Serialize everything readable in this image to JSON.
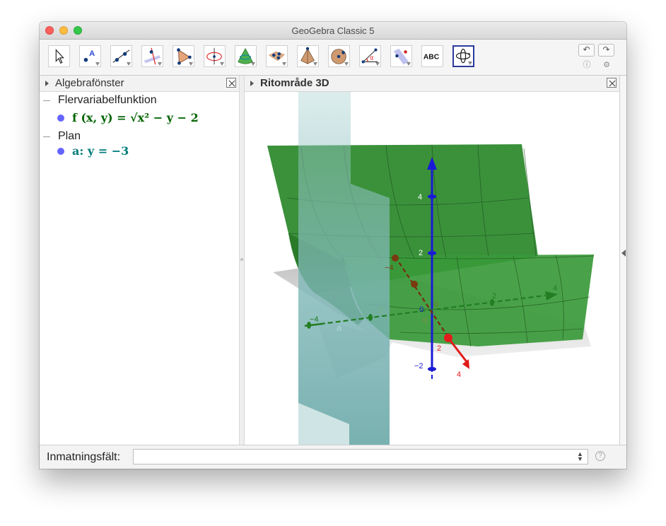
{
  "window": {
    "title": "GeoGebra Classic 5"
  },
  "toolbar": {
    "tools": [
      {
        "name": "move-tool-icon",
        "selected": false
      },
      {
        "name": "point-tool-icon",
        "selected": false
      },
      {
        "name": "line-tool-icon",
        "selected": false
      },
      {
        "name": "perpendicular-line-tool-icon",
        "selected": false
      },
      {
        "name": "polygon-tool-icon",
        "selected": false
      },
      {
        "name": "circle-axis-tool-icon",
        "selected": false
      },
      {
        "name": "intersect-surfaces-tool-icon",
        "selected": false
      },
      {
        "name": "plane-tool-icon",
        "selected": false
      },
      {
        "name": "pyramid-tool-icon",
        "selected": false
      },
      {
        "name": "sphere-tool-icon",
        "selected": false
      },
      {
        "name": "angle-tool-icon",
        "selected": false
      },
      {
        "name": "reflect-tool-icon",
        "selected": false
      },
      {
        "name": "text-tool-icon",
        "label": "ABC",
        "selected": false
      },
      {
        "name": "rotate-view-tool-icon",
        "selected": true
      }
    ]
  },
  "algebra": {
    "title": "Algebrafönster",
    "groups": [
      {
        "label": "Flervariabelfunktion",
        "items": [
          {
            "text": "f (x, y)  =  √x² − y − 2",
            "color": "#006400"
          }
        ]
      },
      {
        "label": "Plan",
        "items": [
          {
            "text": "a: y = −3",
            "color": "#007b7b"
          }
        ]
      }
    ]
  },
  "view3d": {
    "title": "Ritområde 3D",
    "axis_labels": {
      "z_pos4": "4",
      "z_pos2": "2",
      "z_zero": "0",
      "z_neg2": "−2",
      "y_pos2": "2",
      "y_pos4": "4",
      "y_neg4": "−4",
      "y_neg2": "2",
      "x_pos2": "2",
      "x_pos4": "4",
      "x_neg4": "−4",
      "origin_a": "0",
      "origin_b": "0",
      "plane_label": "a"
    }
  },
  "input_bar": {
    "label": "Inmatningsfält:",
    "value": "",
    "help": "?"
  },
  "colors": {
    "surface": "#2e8b2e",
    "plane": "#7fb7b7",
    "z_axis": "#1a1ad6",
    "x_axis": "#e21b1b",
    "y_axis": "#237d23",
    "selected_tool_border": "#2b3a9e"
  }
}
